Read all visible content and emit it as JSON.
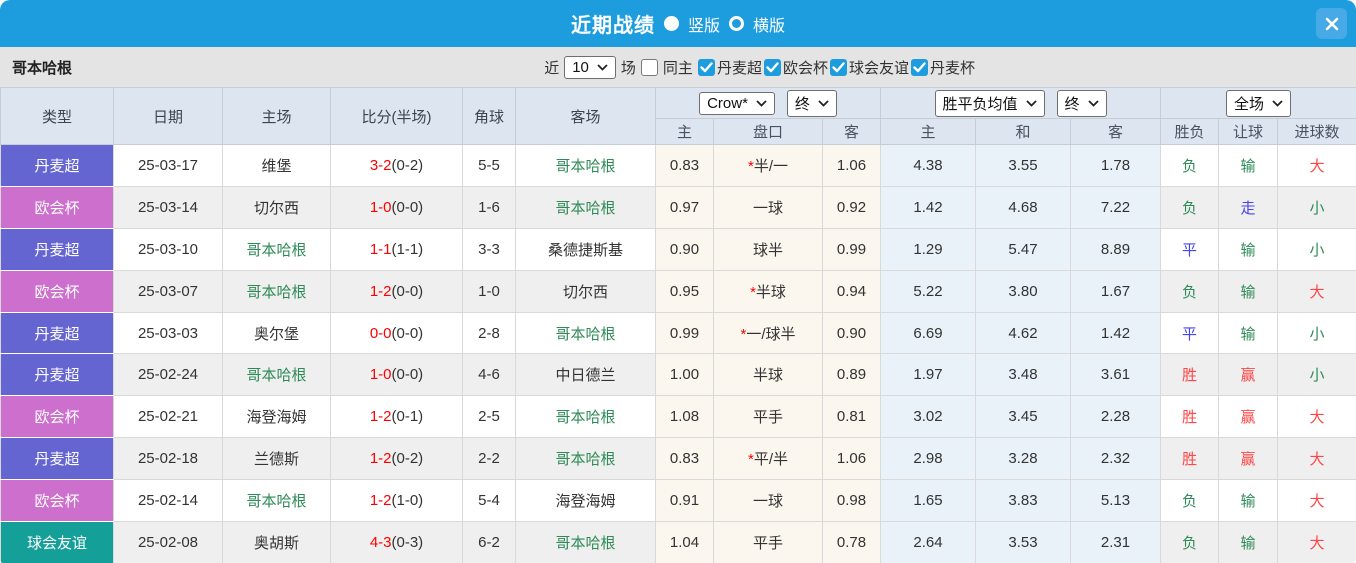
{
  "titlebar": {
    "title": "近期战绩",
    "vertical_label": "竖版",
    "horizontal_label": "横版",
    "vertical_selected": true,
    "close_icon": "x"
  },
  "filter": {
    "team": "哥本哈根",
    "near_label": "近",
    "count_value": "10",
    "games_label": "场",
    "same_home_label": "同主",
    "same_home_checked": false,
    "leagues": [
      "丹麦超",
      "欧会杯",
      "球会友谊",
      "丹麦杯"
    ],
    "leagues_checked": [
      true,
      true,
      true,
      true
    ]
  },
  "table": {
    "headers": {
      "type": "类型",
      "date": "日期",
      "home": "主场",
      "score": "比分(半场)",
      "corner": "角球",
      "away": "客场",
      "crow_select": "Crow*",
      "crow_time_select": "终",
      "avg_select": "胜平负均值",
      "avg_time_select": "终",
      "fulltime_select": "全场",
      "sub": [
        "主",
        "盘口",
        "客",
        "主",
        "和",
        "客",
        "胜负",
        "让球",
        "进球数"
      ]
    },
    "rows": [
      {
        "type": "丹麦超",
        "type_color": "#6565D2",
        "date": "25-03-17",
        "home": "维堡",
        "home_green": false,
        "score_ft": "3-2",
        "score_ht": "(0-2)",
        "corner": "5-5",
        "away": "哥本哈根",
        "away_green": true,
        "odds_home": "0.83",
        "handicap_star": "*",
        "handicap": "半/一",
        "odds_away": "1.06",
        "avg_home": "4.38",
        "avg_draw": "3.55",
        "avg_away": "1.78",
        "result": "负",
        "result_color": "green",
        "give": "输",
        "give_color": "green",
        "goals": "大",
        "goals_color": "red"
      },
      {
        "type": "欧会杯",
        "type_color": "#CD6FCD",
        "date": "25-03-14",
        "home": "切尔西",
        "home_green": false,
        "score_ft": "1-0",
        "score_ht": "(0-0)",
        "corner": "1-6",
        "away": "哥本哈根",
        "away_green": true,
        "odds_home": "0.97",
        "handicap_star": "",
        "handicap": "一球",
        "odds_away": "0.92",
        "avg_home": "1.42",
        "avg_draw": "4.68",
        "avg_away": "7.22",
        "result": "负",
        "result_color": "green",
        "give": "走",
        "give_color": "blue",
        "goals": "小",
        "goals_color": "green"
      },
      {
        "type": "丹麦超",
        "type_color": "#6565D2",
        "date": "25-03-10",
        "home": "哥本哈根",
        "home_green": true,
        "score_ft": "1-1",
        "score_ht": "(1-1)",
        "corner": "3-3",
        "away": "桑德捷斯基",
        "away_green": false,
        "odds_home": "0.90",
        "handicap_star": "",
        "handicap": "球半",
        "odds_away": "0.99",
        "avg_home": "1.29",
        "avg_draw": "5.47",
        "avg_away": "8.89",
        "result": "平",
        "result_color": "blue",
        "give": "输",
        "give_color": "green",
        "goals": "小",
        "goals_color": "green"
      },
      {
        "type": "欧会杯",
        "type_color": "#CD6FCD",
        "date": "25-03-07",
        "home": "哥本哈根",
        "home_green": true,
        "score_ft": "1-2",
        "score_ht": "(0-0)",
        "corner": "1-0",
        "away": "切尔西",
        "away_green": false,
        "odds_home": "0.95",
        "handicap_star": "*",
        "handicap": "半球",
        "odds_away": "0.94",
        "avg_home": "5.22",
        "avg_draw": "3.80",
        "avg_away": "1.67",
        "result": "负",
        "result_color": "green",
        "give": "输",
        "give_color": "green",
        "goals": "大",
        "goals_color": "red"
      },
      {
        "type": "丹麦超",
        "type_color": "#6565D2",
        "date": "25-03-03",
        "home": "奥尔堡",
        "home_green": false,
        "score_ft": "0-0",
        "score_ht": "(0-0)",
        "corner": "2-8",
        "away": "哥本哈根",
        "away_green": true,
        "odds_home": "0.99",
        "handicap_star": "*",
        "handicap": "一/球半",
        "odds_away": "0.90",
        "avg_home": "6.69",
        "avg_draw": "4.62",
        "avg_away": "1.42",
        "result": "平",
        "result_color": "blue",
        "give": "输",
        "give_color": "green",
        "goals": "小",
        "goals_color": "green"
      },
      {
        "type": "丹麦超",
        "type_color": "#6565D2",
        "date": "25-02-24",
        "home": "哥本哈根",
        "home_green": true,
        "score_ft": "1-0",
        "score_ht": "(0-0)",
        "corner": "4-6",
        "away": "中日德兰",
        "away_green": false,
        "odds_home": "1.00",
        "handicap_star": "",
        "handicap": "半球",
        "odds_away": "0.89",
        "avg_home": "1.97",
        "avg_draw": "3.48",
        "avg_away": "3.61",
        "result": "胜",
        "result_color": "red",
        "give": "赢",
        "give_color": "red",
        "goals": "小",
        "goals_color": "green"
      },
      {
        "type": "欧会杯",
        "type_color": "#CD6FCD",
        "date": "25-02-21",
        "home": "海登海姆",
        "home_green": false,
        "score_ft": "1-2",
        "score_ht": "(0-1)",
        "corner": "2-5",
        "away": "哥本哈根",
        "away_green": true,
        "odds_home": "1.08",
        "handicap_star": "",
        "handicap": "平手",
        "odds_away": "0.81",
        "avg_home": "3.02",
        "avg_draw": "3.45",
        "avg_away": "2.28",
        "result": "胜",
        "result_color": "red",
        "give": "赢",
        "give_color": "red",
        "goals": "大",
        "goals_color": "red"
      },
      {
        "type": "丹麦超",
        "type_color": "#6565D2",
        "date": "25-02-18",
        "home": "兰德斯",
        "home_green": false,
        "score_ft": "1-2",
        "score_ht": "(0-2)",
        "corner": "2-2",
        "away": "哥本哈根",
        "away_green": true,
        "odds_home": "0.83",
        "handicap_star": "*",
        "handicap": "平/半",
        "odds_away": "1.06",
        "avg_home": "2.98",
        "avg_draw": "3.28",
        "avg_away": "2.32",
        "result": "胜",
        "result_color": "red",
        "give": "赢",
        "give_color": "red",
        "goals": "大",
        "goals_color": "red"
      },
      {
        "type": "欧会杯",
        "type_color": "#CD6FCD",
        "date": "25-02-14",
        "home": "哥本哈根",
        "home_green": true,
        "score_ft": "1-2",
        "score_ht": "(1-0)",
        "corner": "5-4",
        "away": "海登海姆",
        "away_green": false,
        "odds_home": "0.91",
        "handicap_star": "",
        "handicap": "一球",
        "odds_away": "0.98",
        "avg_home": "1.65",
        "avg_draw": "3.83",
        "avg_away": "5.13",
        "result": "负",
        "result_color": "green",
        "give": "输",
        "give_color": "green",
        "goals": "大",
        "goals_color": "red"
      },
      {
        "type": "球会友谊",
        "type_color": "#14A099",
        "date": "25-02-08",
        "home": "奥胡斯",
        "home_green": false,
        "score_ft": "4-3",
        "score_ht": "(0-3)",
        "corner": "6-2",
        "away": "哥本哈根",
        "away_green": true,
        "odds_home": "1.04",
        "handicap_star": "",
        "handicap": "平手",
        "odds_away": "0.78",
        "avg_home": "2.64",
        "avg_draw": "3.53",
        "avg_away": "2.31",
        "result": "负",
        "result_color": "green",
        "give": "输",
        "give_color": "green",
        "goals": "大",
        "goals_color": "red"
      }
    ]
  },
  "colors": {
    "titlebar_blue": "#1D9DDE",
    "checkbox_blue": "#1D9DDE",
    "superliga_purple": "#6565D2",
    "conference_pink": "#CD6FCD",
    "friendly_teal": "#14A099",
    "copenhagen_green": "#2E8B57",
    "score_red": "#FF0000",
    "win_red": "#FF4545",
    "draw_blue": "#4444EE",
    "odds_cream_bg": "#FBF6EE",
    "avg_blue_bg": "#E9F2F8"
  }
}
